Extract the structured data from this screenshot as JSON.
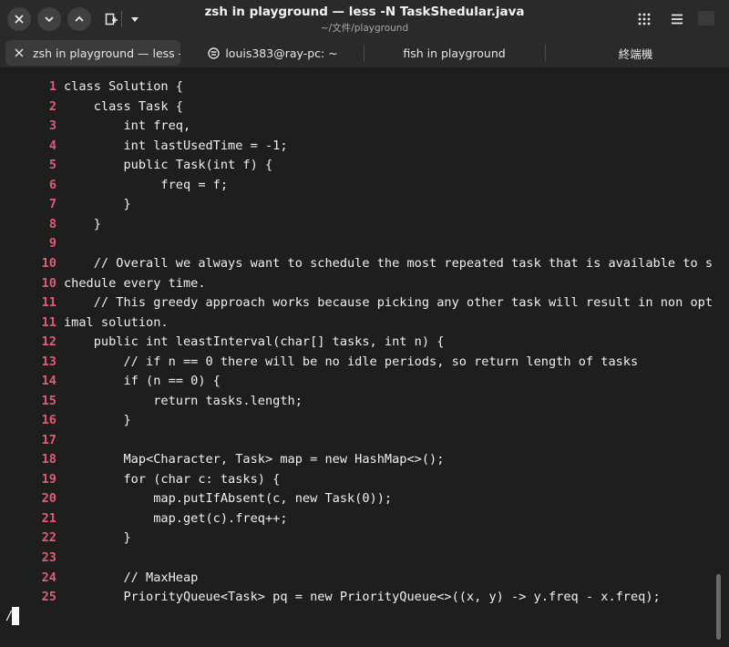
{
  "window": {
    "title": "zsh in playground — less -N TaskShedular.java",
    "subtitle": "~/文件/playground"
  },
  "tabs": [
    {
      "label": "zsh in playground — less -N T",
      "active": true
    },
    {
      "label": "louis383@ray-pc: ~",
      "active": false
    },
    {
      "label": "fish in playground",
      "active": false
    },
    {
      "label": "終端機",
      "active": false
    }
  ],
  "icons": {
    "close": "close-icon",
    "minimize": "chevron-down-icon",
    "maximize": "chevron-up-icon",
    "new_tab": "new-tab-icon",
    "dropdown": "caret-down-icon",
    "grid": "grid-icon",
    "menu": "hamburger-menu-icon",
    "remote": "remote-host-icon"
  },
  "colors": {
    "line_number": "#e35a79",
    "background": "#1e1e1e",
    "text": "#f0f0f0"
  },
  "code_lines": [
    {
      "n": "1",
      "text": "class Solution {"
    },
    {
      "n": "2",
      "text": "    class Task {"
    },
    {
      "n": "3",
      "text": "        int freq,"
    },
    {
      "n": "4",
      "text": "        int lastUsedTime = -1;"
    },
    {
      "n": "5",
      "text": "        public Task(int f) {"
    },
    {
      "n": "6",
      "text": "             freq = f;"
    },
    {
      "n": "7",
      "text": "        }"
    },
    {
      "n": "8",
      "text": "    }"
    },
    {
      "n": "9",
      "text": ""
    },
    {
      "n": "10",
      "text": "    // Overall we always want to schedule the most repeated task that is available to s"
    },
    {
      "n": "10",
      "text": "chedule every time."
    },
    {
      "n": "11",
      "text": "    // This greedy approach works because picking any other task will result in non opt"
    },
    {
      "n": "11",
      "text": "imal solution."
    },
    {
      "n": "12",
      "text": "    public int leastInterval(char[] tasks, int n) {"
    },
    {
      "n": "13",
      "text": "        // if n == 0 there will be no idle periods, so return length of tasks"
    },
    {
      "n": "14",
      "text": "        if (n == 0) {"
    },
    {
      "n": "15",
      "text": "            return tasks.length;"
    },
    {
      "n": "16",
      "text": "        }"
    },
    {
      "n": "17",
      "text": ""
    },
    {
      "n": "18",
      "text": "        Map<Character, Task> map = new HashMap<>();"
    },
    {
      "n": "19",
      "text": "        for (char c: tasks) {"
    },
    {
      "n": "20",
      "text": "            map.putIfAbsent(c, new Task(0));"
    },
    {
      "n": "21",
      "text": "            map.get(c).freq++;"
    },
    {
      "n": "22",
      "text": "        }"
    },
    {
      "n": "23",
      "text": ""
    },
    {
      "n": "24",
      "text": "        // MaxHeap"
    },
    {
      "n": "25",
      "text": "        PriorityQueue<Task> pq = new PriorityQueue<>((x, y) -> y.freq - x.freq);"
    }
  ],
  "prompt": "/"
}
